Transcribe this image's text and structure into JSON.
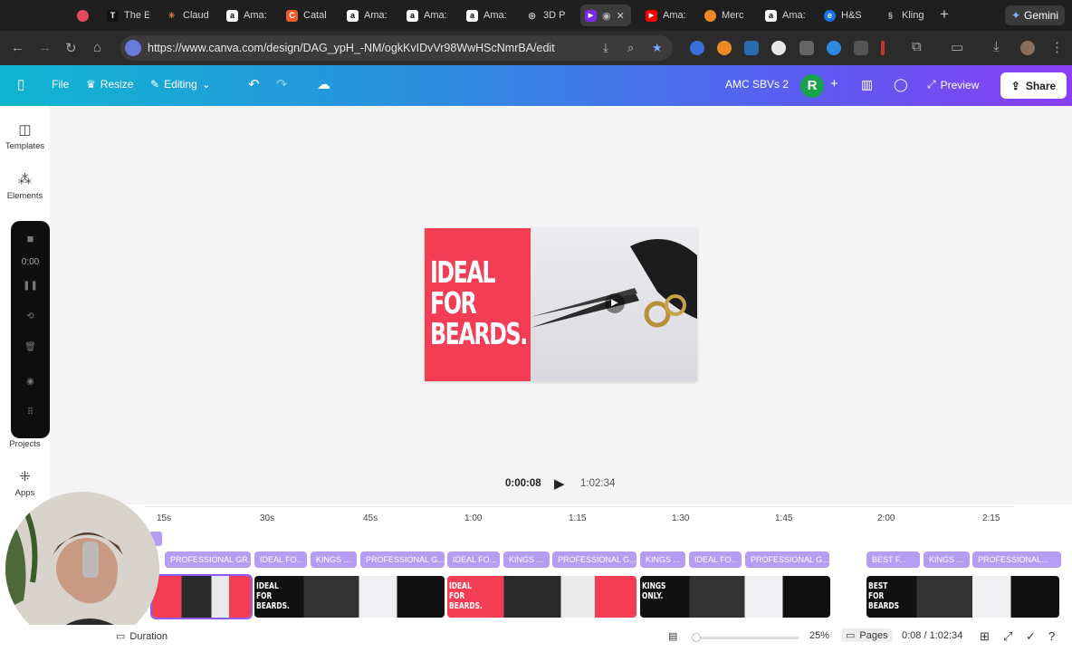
{
  "browser": {
    "tabs": [
      {
        "label": "",
        "fav_color": "#e64a5e",
        "fav_glyph": ""
      },
      {
        "label": "The E",
        "fav_color": "#111111",
        "fav_glyph": "T"
      },
      {
        "label": "Claud",
        "fav_color": "#d97757",
        "fav_glyph": "✳"
      },
      {
        "label": "Ama:",
        "fav_color": "#ffffff",
        "fav_glyph": "a"
      },
      {
        "label": "Catal",
        "fav_color": "#f05a28",
        "fav_glyph": "C"
      },
      {
        "label": "Ama:",
        "fav_color": "#ffffff",
        "fav_glyph": "a"
      },
      {
        "label": "Ama:",
        "fav_color": "#ffffff",
        "fav_glyph": "a"
      },
      {
        "label": "Ama:",
        "fav_color": "#ffffff",
        "fav_glyph": "a"
      },
      {
        "label": "3D P",
        "fav_color": "#777777",
        "fav_glyph": "◎"
      },
      {
        "label": "",
        "fav_color": "#7d2ae8",
        "fav_glyph": "▶"
      },
      {
        "label": "Ama:",
        "fav_color": "#ff0000",
        "fav_glyph": "▶"
      },
      {
        "label": "Merc",
        "fav_color": "#f08a24",
        "fav_glyph": "●"
      },
      {
        "label": "Ama:",
        "fav_color": "#ffffff",
        "fav_glyph": "a"
      },
      {
        "label": "H&S",
        "fav_color": "#1a73e8",
        "fav_glyph": "e"
      },
      {
        "label": "Kling",
        "fav_color": "#555555",
        "fav_glyph": "§"
      }
    ],
    "new_tab": "+",
    "gemini_label": "Gemini",
    "url": "https://www.canva.com/design/DAG_ypH_-NM/ogkKvIDvVr98WwHScNmrBA/edit"
  },
  "canva": {
    "file_label": "File",
    "resize_label": "Resize",
    "editing_label": "Editing",
    "design_title": "AMC SBVs 2",
    "avatar_initial": "R",
    "preview_label": "Preview",
    "share_label": "Share"
  },
  "rail": {
    "templates": "Templates",
    "elements": "Elements",
    "projects": "Projects",
    "apps": "Apps",
    "recorder_time": "0:00"
  },
  "slide": {
    "headline": "IDEAL\nFOR\nBEARDS."
  },
  "playback": {
    "current": "0:00:08",
    "total": "1:02:34"
  },
  "timeline": {
    "ticks": [
      "15s",
      "30s",
      "45s",
      "1:00",
      "1:15",
      "1:30",
      "1:45",
      "2:00",
      "2:15"
    ],
    "labels": [
      "PROFESSIONAL GR...",
      "IDEAL FO...",
      "KINGS ...",
      "PROFESSIONAL G...",
      "IDEAL FO...",
      "KINGS ...",
      "PROFESSIONAL G...",
      "KINGS ...",
      "IDEAL FO...",
      "PROFESSIONAL G...",
      "BEST F...",
      "KINGS ...",
      "PROFESSIONAL..."
    ],
    "clip_texts": [
      "",
      "IDEAL\nFOR\nBEARDS.",
      "IDEAL\nFOR\nBEARDS.",
      "KINGS\nONLY.",
      "BEST\nFOR\nBEARDS"
    ]
  },
  "footer": {
    "duration_label": "Duration",
    "zoom": "25%",
    "pages_label": "Pages",
    "time": "0:08 / 1:02:34"
  }
}
